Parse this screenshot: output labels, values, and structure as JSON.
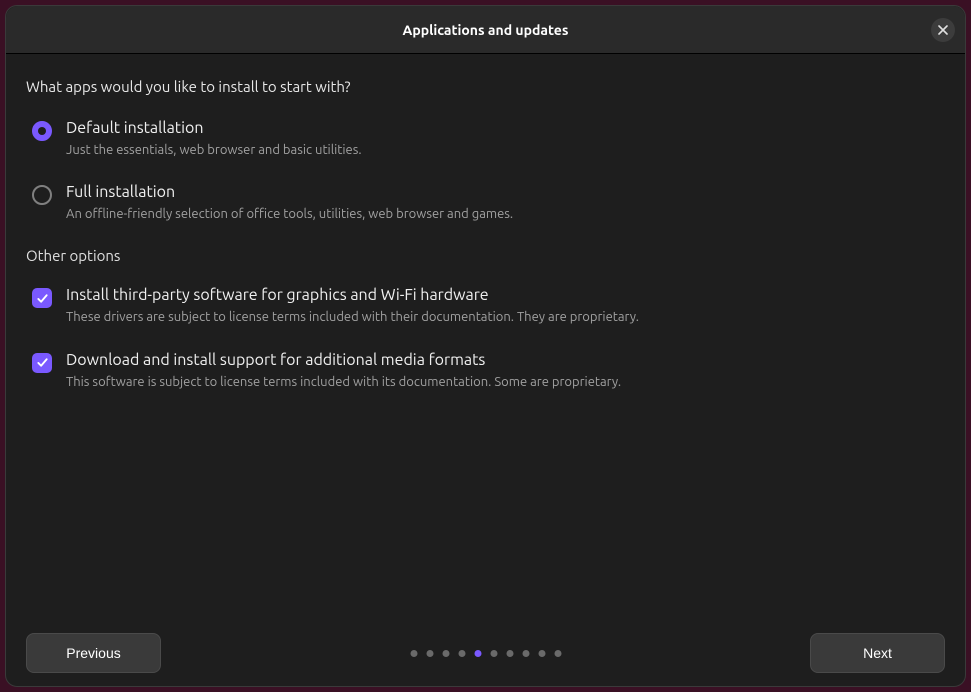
{
  "title": "Applications and updates",
  "question": "What apps would you like to install to start with?",
  "install_options": [
    {
      "id": "default",
      "label": "Default installation",
      "description": "Just the essentials, web browser and basic utilities.",
      "selected": true
    },
    {
      "id": "full",
      "label": "Full installation",
      "description": "An offline-friendly selection of office tools, utilities, web browser and games.",
      "selected": false
    }
  ],
  "other_section_heading": "Other options",
  "other_options": [
    {
      "id": "thirdparty",
      "label": "Install third-party software for graphics and Wi-Fi hardware",
      "description": "These drivers are subject to license terms included with their documentation. They are proprietary.",
      "checked": true
    },
    {
      "id": "media",
      "label": "Download and install support for additional media formats",
      "description": "This software is subject to license terms included with its documentation. Some are proprietary.",
      "checked": true
    }
  ],
  "progress": {
    "total": 10,
    "current": 5
  },
  "buttons": {
    "previous": "Previous",
    "next": "Next"
  }
}
